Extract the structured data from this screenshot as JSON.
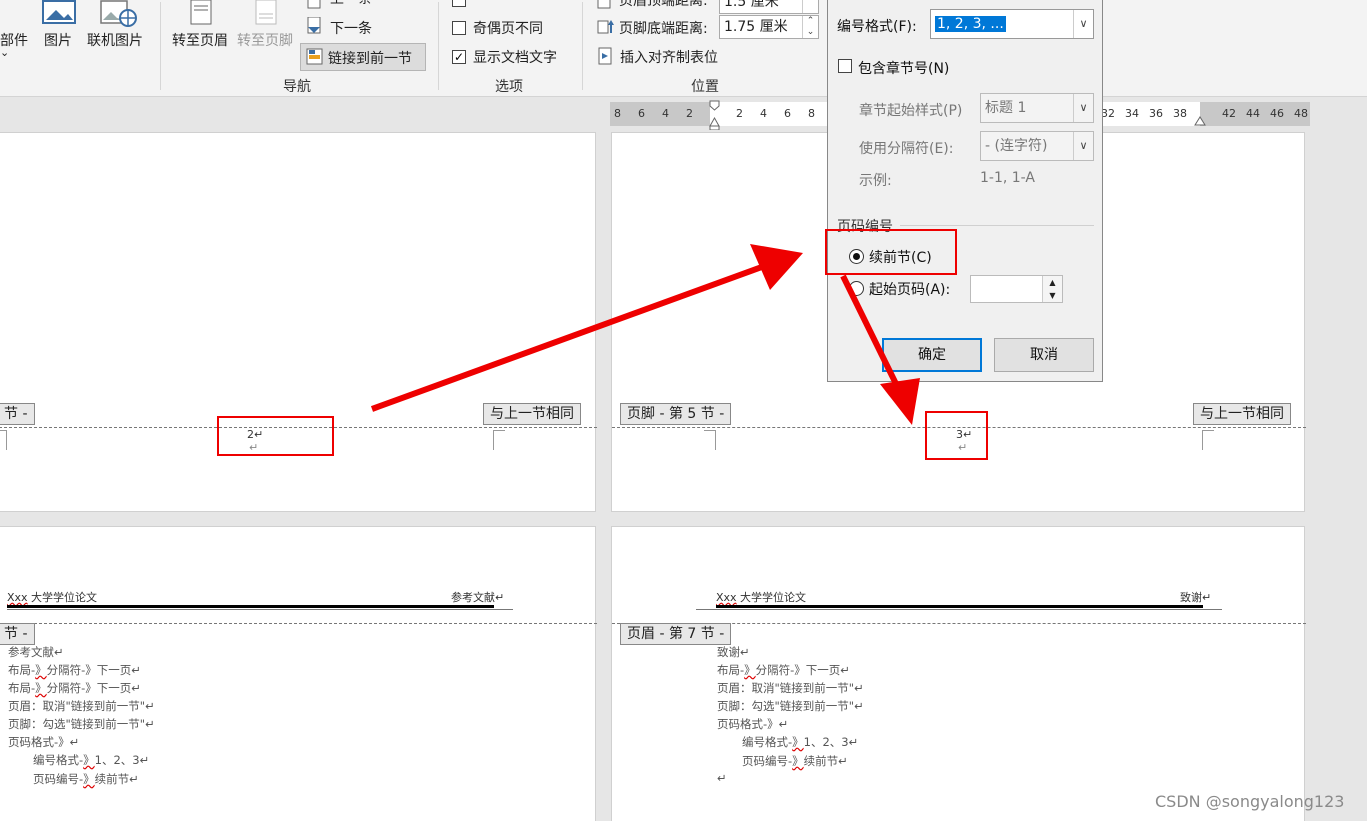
{
  "ribbon": {
    "items": {
      "parts": "部件",
      "parts_chevron": "⌄",
      "picture": "图片",
      "online_picture": "联机图片",
      "goto_header": "转至页眉",
      "goto_footer": "转至页脚",
      "prev": "上一条",
      "next": "下一条",
      "link_prev": "链接到前一节",
      "odd_even": "奇偶页不同",
      "show_doc_text": "显示文档文字",
      "header_top_label": "页眉顶端距离:",
      "header_top_value": "1.5 厘米",
      "footer_bottom_label": "页脚底端距离:",
      "footer_bottom_value": "1.75 厘米",
      "insert_align_tab": "插入对齐制表位"
    },
    "groups": {
      "nav": "导航",
      "options": "选项",
      "position": "位置"
    }
  },
  "ruler": {
    "ticks": [
      "8",
      "6",
      "4",
      "2",
      "2",
      "4",
      "6",
      "8",
      "32",
      "34",
      "36",
      "38",
      "42",
      "44",
      "46",
      "48"
    ]
  },
  "pages": {
    "p1": {
      "footer_tag": "节 -",
      "same_as_prev": "与上一节相同",
      "page_num": "2↵",
      "para": "↵"
    },
    "p2": {
      "footer_tag": "页脚 - 第 5 节 -",
      "same_as_prev": "与上一节相同",
      "page_num": "3↵",
      "para": "↵"
    },
    "p3": {
      "header_left_xxx": "Xxx",
      "header_left": " 大学学位论文",
      "header_right": "参考文献↵",
      "section_tag": "节 -",
      "lines": [
        {
          "a": "参考文献↵",
          "w": "",
          "b": ""
        },
        {
          "a": "布局-",
          "w": "》",
          "b": "分隔符-》下一页↵"
        },
        {
          "a": "布局-",
          "w": "》",
          "b": "分隔符-》下一页↵"
        },
        {
          "a": "页眉：取消\"链接到前一节\"↵",
          "w": "",
          "b": ""
        },
        {
          "a": "页脚：勾选\"链接到前一节\"↵",
          "w": "",
          "b": ""
        },
        {
          "a": "页码格式-》↵",
          "w": "",
          "b": ""
        },
        {
          "a": "编号格式-",
          "w": "》",
          "b": "1、2、3↵"
        },
        {
          "a": "页码编号-",
          "w": "》",
          "b": "续前节↵"
        }
      ]
    },
    "p4": {
      "header_left_xxx": "Xxx",
      "header_left": " 大学学位论文",
      "header_right": "致谢↵",
      "section_tag": "页眉 - 第 7 节 -",
      "lines": [
        {
          "a": "致谢↵",
          "w": "",
          "b": ""
        },
        {
          "a": "布局-",
          "w": "》",
          "b": "分隔符-》下一页↵"
        },
        {
          "a": "页眉：取消\"链接到前一节\"↵",
          "w": "",
          "b": ""
        },
        {
          "a": "页脚：勾选\"链接到前一节\"↵",
          "w": "",
          "b": ""
        },
        {
          "a": "页码格式-》↵",
          "w": "",
          "b": ""
        },
        {
          "a": "编号格式-",
          "w": "》",
          "b": "1、2、3↵"
        },
        {
          "a": "页码编号-",
          "w": "》",
          "b": "续前节↵"
        },
        {
          "a": "↵",
          "w": "",
          "b": ""
        }
      ]
    }
  },
  "dialog": {
    "number_format_label": "编号格式(F):",
    "number_format_value": "1, 2, 3, ...",
    "include_chapter": "包含章节号(N)",
    "chapter_start_label": "章节起始样式(P)",
    "chapter_start_value": "标题 1",
    "separator_label": "使用分隔符(E):",
    "separator_value": "-  (连字符)",
    "example_label": "示例:",
    "example_value": "1-1, 1-A",
    "page_numbering_title": "页码编号",
    "continue_prev": "续前节(C)",
    "start_at": "起始页码(A):",
    "start_at_value": "",
    "ok": "确定",
    "cancel": "取消"
  },
  "watermark": "CSDN @songyalong123",
  "colors": {
    "accent": "#0078d7",
    "annotation_red": "#e00000"
  }
}
